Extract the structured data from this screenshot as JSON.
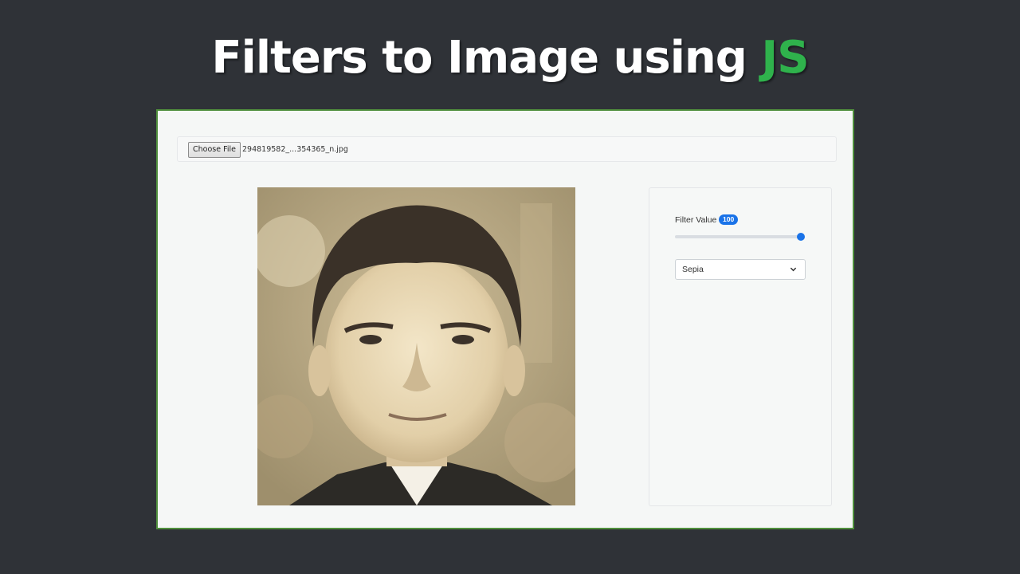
{
  "headline": {
    "text": "Filters to Image using ",
    "accent": "JS"
  },
  "colors": {
    "accent": "#2fb24c",
    "frame_border": "#4f8f3c",
    "badge": "#1a73e8"
  },
  "file_input": {
    "button_label": "Choose File",
    "file_name": "294819582_...354365_n.jpg"
  },
  "controls": {
    "filter_label": "Filter Value",
    "filter_value": "100",
    "slider_fraction": 1.0,
    "filter_select": {
      "selected": "Sepia"
    }
  },
  "image": {
    "filter": "sepia"
  }
}
